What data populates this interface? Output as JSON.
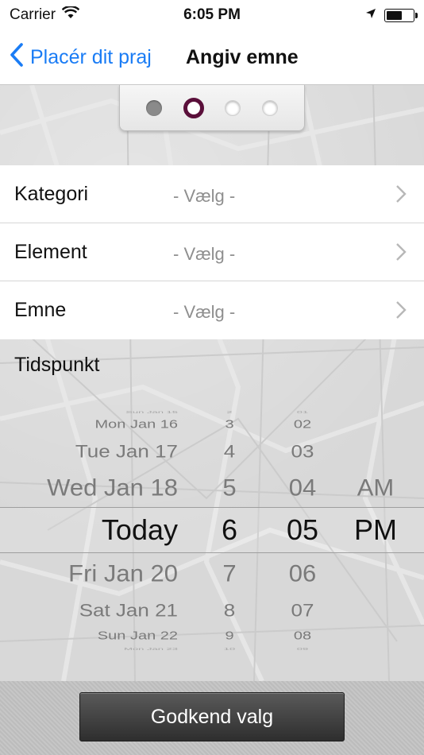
{
  "status_bar": {
    "carrier": "Carrier",
    "time": "6:05 PM",
    "icons": [
      "wifi-icon",
      "location-arrow-icon",
      "battery-icon"
    ]
  },
  "nav": {
    "back_label": "Placér dit praj",
    "title": "Angiv emne",
    "accent_color": "#1a7cf5"
  },
  "steps": {
    "total": 4,
    "completed": 1,
    "current": 2,
    "active_color": "#5a0f3a"
  },
  "form": {
    "rows": [
      {
        "label": "Kategori",
        "value": "- Vælg -"
      },
      {
        "label": "Element",
        "value": "- Vælg -"
      },
      {
        "label": "Emne",
        "value": "- Vælg -"
      }
    ]
  },
  "time": {
    "label": "Tidspunkt",
    "picker": {
      "dates": [
        "Sun Jan 15",
        "Mon Jan 16",
        "Tue Jan 17",
        "Wed Jan 18",
        "Today",
        "Fri Jan 20",
        "Sat Jan 21",
        "Sun Jan 22",
        "Mon Jan 23"
      ],
      "hours": [
        "2",
        "3",
        "4",
        "5",
        "6",
        "7",
        "8",
        "9",
        "10"
      ],
      "minutes": [
        "01",
        "02",
        "03",
        "04",
        "05",
        "06",
        "07",
        "08",
        "09"
      ],
      "ampm": [
        "",
        "",
        "",
        "AM",
        "PM",
        "",
        "",
        "",
        ""
      ],
      "selected_index": 4
    }
  },
  "bottom": {
    "confirm_label": "Godkend valg"
  }
}
